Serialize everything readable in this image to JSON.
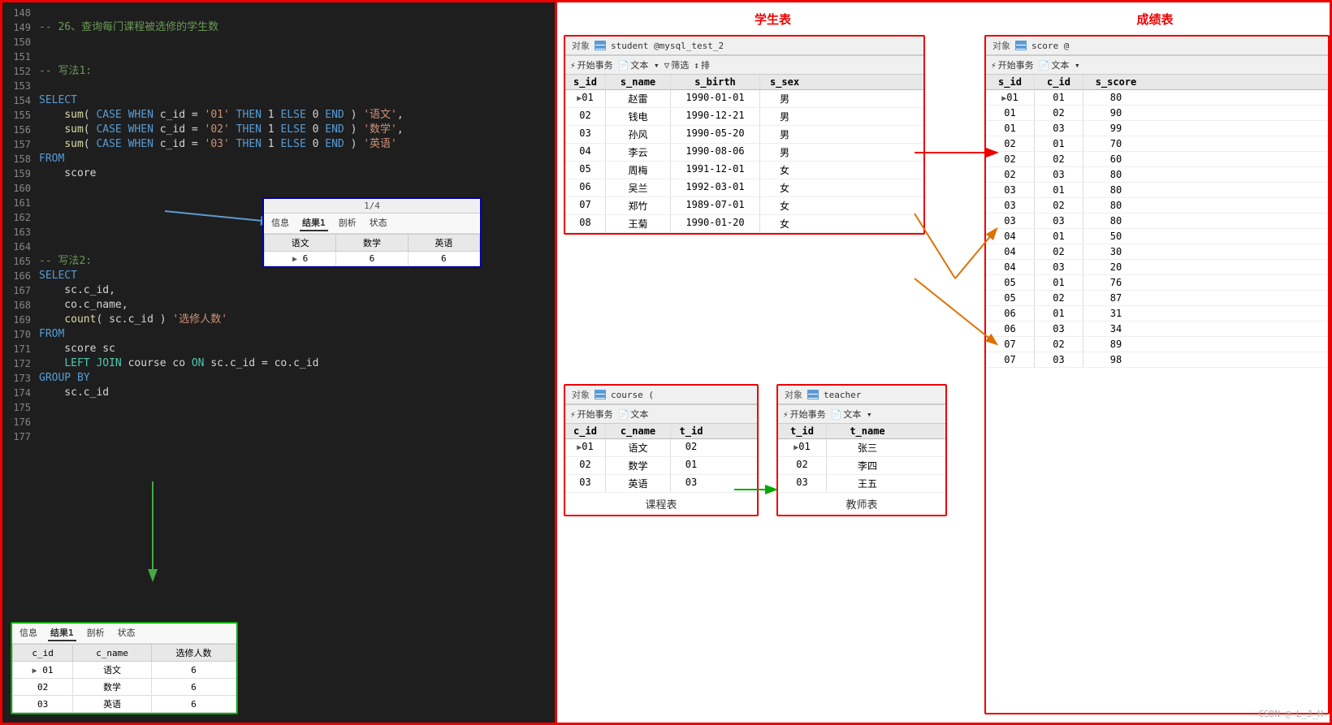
{
  "code": {
    "lines": [
      {
        "num": 148,
        "content": "",
        "tokens": []
      },
      {
        "num": 149,
        "content": "-- 26、查询每门课程被选修的学生数",
        "type": "comment"
      },
      {
        "num": 150,
        "content": "",
        "tokens": []
      },
      {
        "num": 151,
        "content": "",
        "tokens": []
      },
      {
        "num": 152,
        "content": "-- 写法1:",
        "type": "comment"
      },
      {
        "num": 153,
        "content": "",
        "tokens": []
      },
      {
        "num": 154,
        "content": "SELECT",
        "type": "keyword"
      },
      {
        "num": 155,
        "content": "    sum( CASE WHEN c_id = '01' THEN 1 ELSE 0 END ) '语文',",
        "mixed": true
      },
      {
        "num": 156,
        "content": "    sum( CASE WHEN c_id = '02' THEN 1 ELSE 0 END ) '数学',",
        "mixed": true
      },
      {
        "num": 157,
        "content": "    sum( CASE WHEN c_id = '03' THEN 1 ELSE 0 END ) '英语'",
        "mixed": true
      },
      {
        "num": 158,
        "content": "FROM",
        "type": "keyword"
      },
      {
        "num": 159,
        "content": "    score",
        "type": "plain"
      },
      {
        "num": 160,
        "content": "",
        "tokens": []
      },
      {
        "num": 161,
        "content": "",
        "tokens": []
      },
      {
        "num": 162,
        "content": "",
        "tokens": []
      },
      {
        "num": 163,
        "content": "",
        "tokens": []
      },
      {
        "num": 164,
        "content": "",
        "tokens": []
      },
      {
        "num": 165,
        "content": "-- 写法2:",
        "type": "comment"
      },
      {
        "num": 166,
        "content": "SELECT",
        "type": "keyword"
      },
      {
        "num": 167,
        "content": "    sc.c_id,",
        "type": "plain"
      },
      {
        "num": 168,
        "content": "    co.c_name,",
        "type": "plain"
      },
      {
        "num": 169,
        "content": "    count( sc.c_id ) '选修人数'",
        "mixed2": true
      },
      {
        "num": 170,
        "content": "FROM",
        "type": "keyword"
      },
      {
        "num": 171,
        "content": "    score sc",
        "type": "plain"
      },
      {
        "num": 172,
        "content": "    LEFT JOIN course co ON sc.c_id = co.c_id",
        "join": true
      },
      {
        "num": 173,
        "content": "GROUP BY",
        "type": "keyword"
      },
      {
        "num": 174,
        "content": "    sc.c_id",
        "type": "plain"
      },
      {
        "num": 175,
        "content": "",
        "tokens": []
      },
      {
        "num": 176,
        "content": "",
        "tokens": []
      },
      {
        "num": 177,
        "content": "",
        "tokens": []
      }
    ]
  },
  "result1": {
    "title": "1/4",
    "tabs": [
      "信息",
      "结果1",
      "剖析",
      "状态"
    ],
    "active_tab": "结果1",
    "headers": [
      "语文",
      "数学",
      "英语"
    ],
    "rows": [
      [
        "6",
        "6",
        "6"
      ]
    ]
  },
  "result2": {
    "tabs": [
      "信息",
      "结果1",
      "剖析",
      "状态"
    ],
    "active_tab": "结果1",
    "headers": [
      "c_id",
      "c_name",
      "选修人数"
    ],
    "rows": [
      [
        "01",
        "语文",
        "6"
      ],
      [
        "02",
        "数学",
        "6"
      ],
      [
        "03",
        "英语",
        "6"
      ]
    ]
  },
  "student_table": {
    "title": "学生表",
    "obj_label": "对象",
    "obj_name": "student @mysql_test_2",
    "toolbar": [
      "开始事务",
      "文本",
      "筛选",
      "排"
    ],
    "headers": [
      "s_id",
      "s_name",
      "s_birth",
      "s_sex"
    ],
    "rows": [
      [
        "01",
        "赵雷",
        "1990-01-01",
        "男"
      ],
      [
        "02",
        "钱电",
        "1990-12-21",
        "男"
      ],
      [
        "03",
        "孙风",
        "1990-05-20",
        "男"
      ],
      [
        "04",
        "李云",
        "1990-08-06",
        "男"
      ],
      [
        "05",
        "周梅",
        "1991-12-01",
        "女"
      ],
      [
        "06",
        "吴兰",
        "1992-03-01",
        "女"
      ],
      [
        "07",
        "郑竹",
        "1989-07-01",
        "女"
      ],
      [
        "08",
        "王菊",
        "1990-01-20",
        "女"
      ]
    ]
  },
  "score_table": {
    "title": "成绩表",
    "obj_label": "对象",
    "obj_name": "score @",
    "toolbar": [
      "开始事务",
      "文本"
    ],
    "headers": [
      "s_id",
      "c_id",
      "s_score"
    ],
    "rows": [
      [
        "01",
        "01",
        "80"
      ],
      [
        "01",
        "02",
        "90"
      ],
      [
        "01",
        "03",
        "99"
      ],
      [
        "02",
        "01",
        "70"
      ],
      [
        "02",
        "02",
        "60"
      ],
      [
        "02",
        "03",
        "80"
      ],
      [
        "03",
        "01",
        "80"
      ],
      [
        "03",
        "02",
        "80"
      ],
      [
        "03",
        "03",
        "80"
      ],
      [
        "04",
        "01",
        "50"
      ],
      [
        "04",
        "02",
        "30"
      ],
      [
        "04",
        "03",
        "20"
      ],
      [
        "05",
        "01",
        "76"
      ],
      [
        "05",
        "02",
        "87"
      ],
      [
        "06",
        "01",
        "31"
      ],
      [
        "06",
        "03",
        "34"
      ],
      [
        "07",
        "02",
        "89"
      ],
      [
        "07",
        "03",
        "98"
      ]
    ]
  },
  "course_table": {
    "title": "课程表",
    "obj_label": "对象",
    "obj_name": "course (",
    "toolbar": [
      "开始事务",
      "文本"
    ],
    "headers": [
      "c_id",
      "c_name",
      "t_id"
    ],
    "rows": [
      [
        "01",
        "语文",
        "02"
      ],
      [
        "02",
        "数学",
        "01"
      ],
      [
        "03",
        "英语",
        "03"
      ]
    ]
  },
  "teacher_table": {
    "title": "教师表",
    "obj_label": "对象",
    "obj_name": "teacher",
    "toolbar": [
      "开始事务",
      "文本"
    ],
    "headers": [
      "t_id",
      "t_name"
    ],
    "rows": [
      [
        "01",
        "张三"
      ],
      [
        "02",
        "李四"
      ],
      [
        "03",
        "王五"
      ]
    ]
  },
  "watermark": "CSDN @ L_J_H"
}
